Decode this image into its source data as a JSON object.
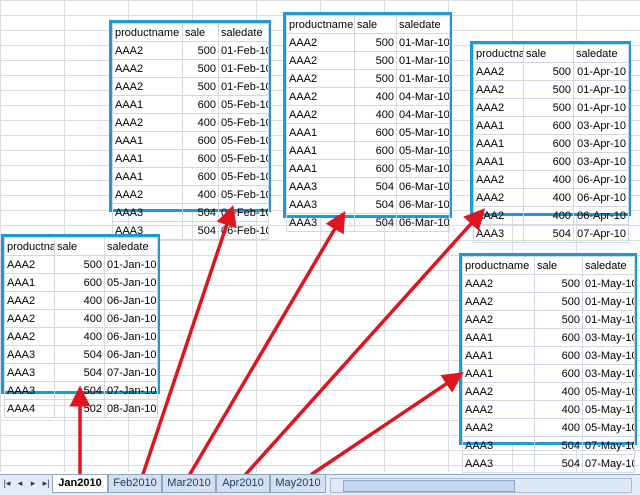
{
  "sheets": {
    "jan": {
      "headers": [
        "productname",
        "sale",
        "saledate"
      ],
      "rows": [
        [
          "AAA2",
          "500",
          "01-Jan-10"
        ],
        [
          "AAA1",
          "600",
          "05-Jan-10"
        ],
        [
          "AAA2",
          "400",
          "06-Jan-10"
        ],
        [
          "AAA2",
          "400",
          "06-Jan-10"
        ],
        [
          "AAA2",
          "400",
          "06-Jan-10"
        ],
        [
          "AAA3",
          "504",
          "06-Jan-10"
        ],
        [
          "AAA3",
          "504",
          "07-Jan-10"
        ],
        [
          "AAA3",
          "504",
          "07-Jan-10"
        ],
        [
          "AAA4",
          "502",
          "08-Jan-10"
        ]
      ]
    },
    "feb": {
      "headers": [
        "productname",
        "sale",
        "saledate"
      ],
      "rows": [
        [
          "AAA2",
          "500",
          "01-Feb-10"
        ],
        [
          "AAA2",
          "500",
          "01-Feb-10"
        ],
        [
          "AAA2",
          "500",
          "01-Feb-10"
        ],
        [
          "AAA1",
          "600",
          "05-Feb-10"
        ],
        [
          "AAA2",
          "400",
          "05-Feb-10"
        ],
        [
          "AAA1",
          "600",
          "05-Feb-10"
        ],
        [
          "AAA1",
          "600",
          "05-Feb-10"
        ],
        [
          "AAA1",
          "600",
          "05-Feb-10"
        ],
        [
          "AAA2",
          "400",
          "05-Feb-10"
        ],
        [
          "AAA3",
          "504",
          "06-Feb-10"
        ],
        [
          "AAA3",
          "504",
          "06-Feb-10"
        ]
      ]
    },
    "mar": {
      "headers": [
        "productname",
        "sale",
        "saledate"
      ],
      "rows": [
        [
          "AAA2",
          "500",
          "01-Mar-10"
        ],
        [
          "AAA2",
          "500",
          "01-Mar-10"
        ],
        [
          "AAA2",
          "500",
          "01-Mar-10"
        ],
        [
          "AAA2",
          "400",
          "04-Mar-10"
        ],
        [
          "AAA2",
          "400",
          "04-Mar-10"
        ],
        [
          "AAA1",
          "600",
          "05-Mar-10"
        ],
        [
          "AAA1",
          "600",
          "05-Mar-10"
        ],
        [
          "AAA1",
          "600",
          "05-Mar-10"
        ],
        [
          "AAA3",
          "504",
          "06-Mar-10"
        ],
        [
          "AAA3",
          "504",
          "06-Mar-10"
        ],
        [
          "AAA3",
          "504",
          "06-Mar-10"
        ]
      ]
    },
    "apr": {
      "headers": [
        "productna",
        "sale",
        "saledate"
      ],
      "rows": [
        [
          "AAA2",
          "500",
          "01-Apr-10"
        ],
        [
          "AAA2",
          "500",
          "01-Apr-10"
        ],
        [
          "AAA2",
          "500",
          "01-Apr-10"
        ],
        [
          "AAA1",
          "600",
          "03-Apr-10"
        ],
        [
          "AAA1",
          "600",
          "03-Apr-10"
        ],
        [
          "AAA1",
          "600",
          "03-Apr-10"
        ],
        [
          "AAA2",
          "400",
          "06-Apr-10"
        ],
        [
          "AAA2",
          "400",
          "06-Apr-10"
        ],
        [
          "AAA2",
          "400",
          "06-Apr-10"
        ],
        [
          "AAA3",
          "504",
          "07-Apr-10"
        ]
      ]
    },
    "may": {
      "headers": [
        "productname",
        "sale",
        "saledate"
      ],
      "rows": [
        [
          "AAA2",
          "500",
          "01-May-10"
        ],
        [
          "AAA2",
          "500",
          "01-May-10"
        ],
        [
          "AAA2",
          "500",
          "01-May-10"
        ],
        [
          "AAA1",
          "600",
          "03-May-10"
        ],
        [
          "AAA1",
          "600",
          "03-May-10"
        ],
        [
          "AAA1",
          "600",
          "03-May-10"
        ],
        [
          "AAA2",
          "400",
          "05-May-10"
        ],
        [
          "AAA2",
          "400",
          "05-May-10"
        ],
        [
          "AAA2",
          "400",
          "05-May-10"
        ],
        [
          "AAA3",
          "504",
          "07-May-10"
        ],
        [
          "AAA3",
          "504",
          "07-May-10"
        ]
      ]
    }
  },
  "tabs": {
    "jan": "Jan2010",
    "feb": "Feb2010",
    "mar": "Mar2010",
    "apr": "Apr2010",
    "may": "May2010"
  },
  "colors": {
    "highlight_border": "#1b9ad6",
    "arrow": "#e0141e"
  },
  "icons": [
    "first-sheet-icon",
    "prev-sheet-icon",
    "next-sheet-icon",
    "last-sheet-icon"
  ]
}
